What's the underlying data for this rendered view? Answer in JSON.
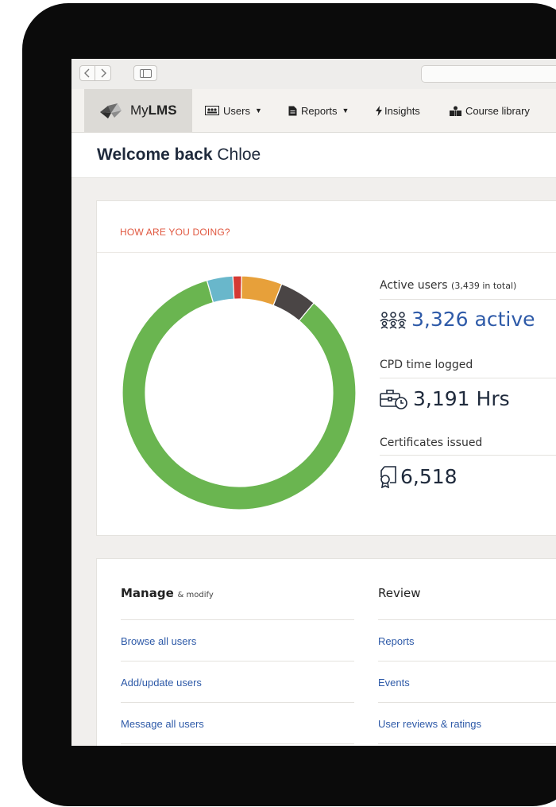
{
  "colors": {
    "accent_blue": "#2e5aa8",
    "heading_orange": "#e0573f",
    "donut_green": "#6ab550",
    "donut_blue": "#69b7cb",
    "donut_red": "#d53a34",
    "donut_orange": "#e7a03a",
    "donut_dark": "#4a4545"
  },
  "brand": {
    "prefix": "My",
    "bold": "LMS",
    "icon": "lms-logo-icon"
  },
  "nav": [
    {
      "label": "Users",
      "icon": "users-icon",
      "dropdown": true
    },
    {
      "label": "Reports",
      "icon": "report-document-icon",
      "dropdown": true
    },
    {
      "label": "Insights",
      "icon": "lightning-icon",
      "dropdown": false
    },
    {
      "label": "Course library",
      "icon": "course-library-icon",
      "dropdown": false
    }
  ],
  "welcome": {
    "bold": "Welcome back",
    "name": "Chloe"
  },
  "stats_card": {
    "heading": "HOW ARE YOU DOING?",
    "active_users_label": "Active users",
    "active_users_total": "(3,439 in total)",
    "active_users_value": "3,326 active",
    "cpd_label": "CPD time logged",
    "cpd_value": "3,191 Hrs",
    "certificates_label": "Certificates issued",
    "certificates_value": "6,518"
  },
  "chart_data": {
    "type": "pie",
    "segments": [
      {
        "value": 84.5,
        "color": "#6ab550"
      },
      {
        "value": 3.6,
        "color": "#69b7cb"
      },
      {
        "value": 1.2,
        "color": "#d53a34"
      },
      {
        "value": 5.6,
        "color": "#e7a03a"
      },
      {
        "value": 5.1,
        "color": "#4a4545"
      }
    ]
  },
  "manage": {
    "title": "Manage",
    "subtitle": "& modify",
    "links": [
      "Browse all users",
      "Add/update users",
      "Message all users"
    ]
  },
  "review": {
    "title": "Review",
    "links": [
      "Reports",
      "Events",
      "User reviews & ratings"
    ]
  }
}
